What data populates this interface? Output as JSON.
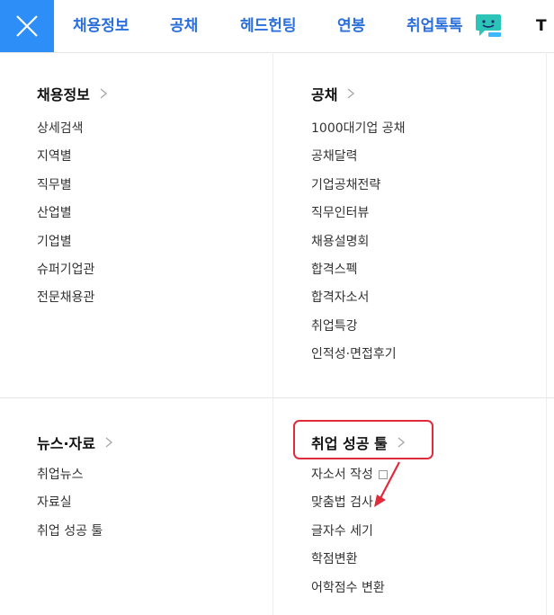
{
  "nav": {
    "tabs": [
      {
        "label": "채용정보"
      },
      {
        "label": "공채"
      },
      {
        "label": "헤드헌팅"
      },
      {
        "label": "연봉"
      },
      {
        "label": "취업톡톡"
      },
      {
        "label": "T"
      }
    ],
    "icons": {
      "close": "close-icon",
      "chat": "chat-bubble-face-icon"
    }
  },
  "sections": {
    "jobs": {
      "title": "채용정보",
      "items": [
        "상세검색",
        "지역별",
        "직무별",
        "산업별",
        "기업별",
        "슈퍼기업관",
        "전문채용관"
      ]
    },
    "gongchae": {
      "title": "공채",
      "items": [
        "1000대기업 공채",
        "공채달력",
        "기업공채전략",
        "직무인터뷰",
        "채용설명회",
        "합격스펙",
        "합격자소서",
        "취업특강",
        "인적성·면접후기"
      ]
    },
    "news": {
      "title": "뉴스·자료",
      "items": [
        "취업뉴스",
        "자료실",
        "취업 성공 툴"
      ]
    },
    "tools": {
      "title": "취업 성공 툴",
      "items": [
        "자소서 작성",
        "맞춤법 검사",
        "글자수 세기",
        "학점변환",
        "어학점수 변환"
      ]
    }
  },
  "colors": {
    "accent": "#2d8ef7",
    "nav_text": "#2a6fdb",
    "highlight": "#e02b3b",
    "chat_icon": "#2bc4b6"
  }
}
